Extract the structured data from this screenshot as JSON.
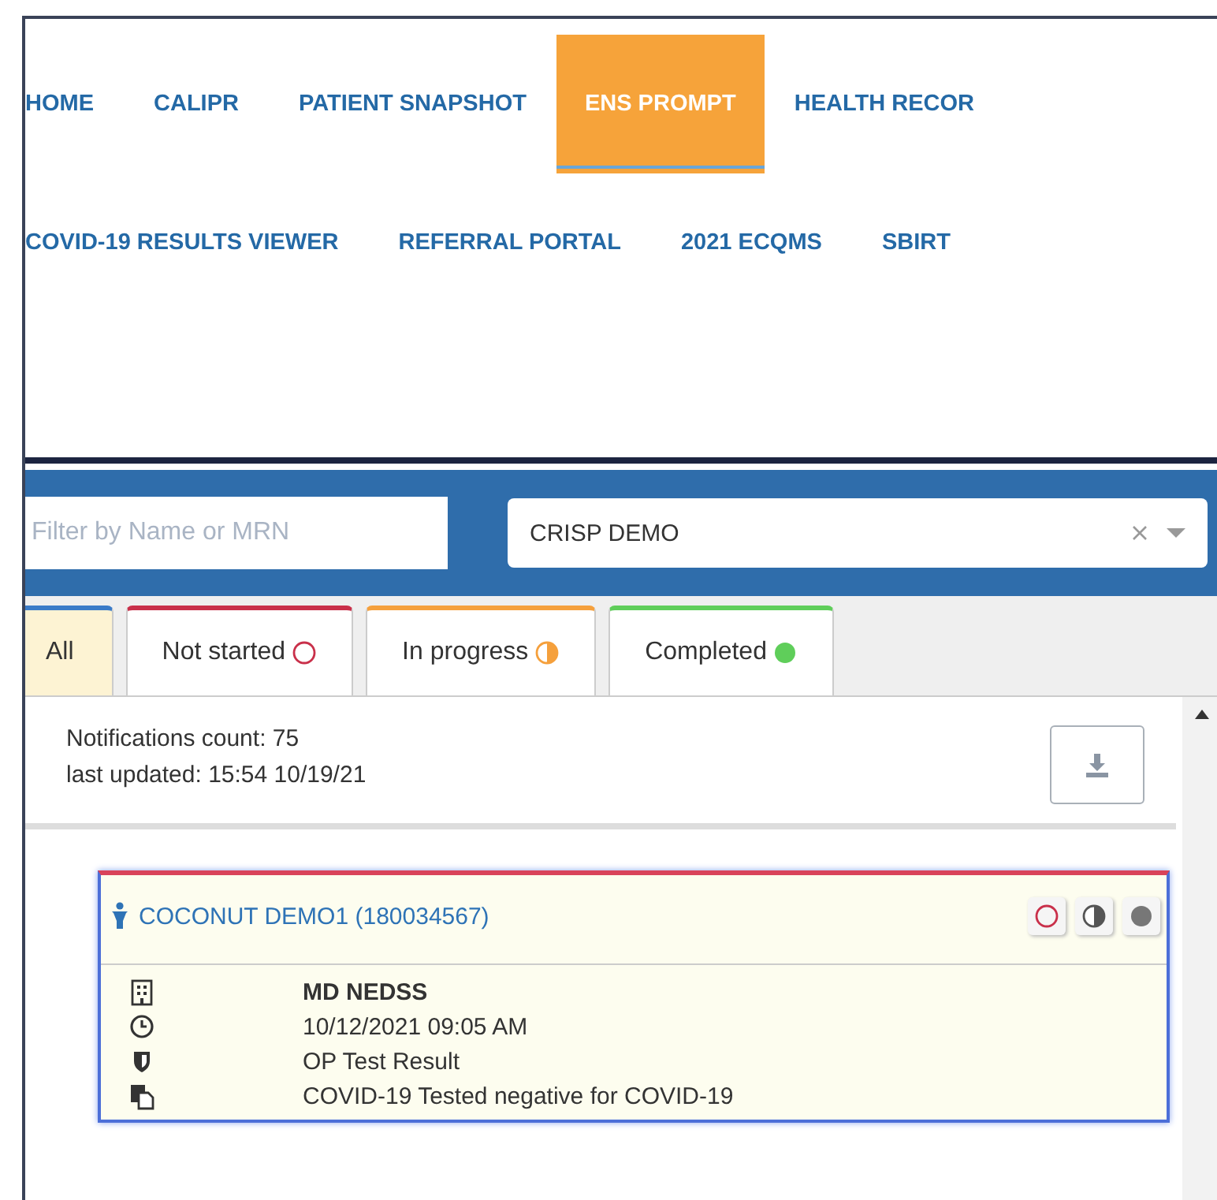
{
  "nav_rows": [
    [
      {
        "label": "HOME",
        "selected": false
      },
      {
        "label": "CALIPR",
        "selected": false
      },
      {
        "label": "PATIENT SNAPSHOT",
        "selected": false
      },
      {
        "label": "ENS PROMPT",
        "selected": true
      },
      {
        "label": "HEALTH RECOR",
        "selected": false
      }
    ],
    [
      {
        "label": "COVID-19 RESULTS VIEWER",
        "selected": false
      },
      {
        "label": "REFERRAL PORTAL",
        "selected": false
      },
      {
        "label": "2021 ECQMS",
        "selected": false
      },
      {
        "label": "SBIRT",
        "selected": false
      }
    ]
  ],
  "filter": {
    "placeholder": "Filter by Name or MRN"
  },
  "organization_select": {
    "value": "CRISP DEMO"
  },
  "tabs": [
    {
      "label": "All",
      "selected": true,
      "color": "#3a7bc8",
      "kind": "plain"
    },
    {
      "label": "Not started",
      "selected": false,
      "color": "#c9304a",
      "kind": "open"
    },
    {
      "label": "In progress",
      "selected": false,
      "color": "#f5a03c",
      "kind": "half"
    },
    {
      "label": "Completed",
      "selected": false,
      "color": "#5fce5a",
      "kind": "filled"
    }
  ],
  "summary": [
    "Notifications count: 75",
    "last updated: 15:54 10/19/21"
  ],
  "card": {
    "patient": "COCONUT DEMO1 (180034567)",
    "status_buttons": [
      {
        "kind": "open"
      },
      {
        "kind": "half"
      },
      {
        "kind": "filled"
      }
    ],
    "rows": [
      {
        "kind": "facility",
        "text": "MD NEDSS"
      },
      {
        "kind": "time",
        "text": "10/12/2021 09:05 AM"
      },
      {
        "kind": "type",
        "text": "OP Test Result"
      },
      {
        "kind": "message",
        "text": "COVID-19 Tested negative for COVID-19"
      }
    ]
  }
}
